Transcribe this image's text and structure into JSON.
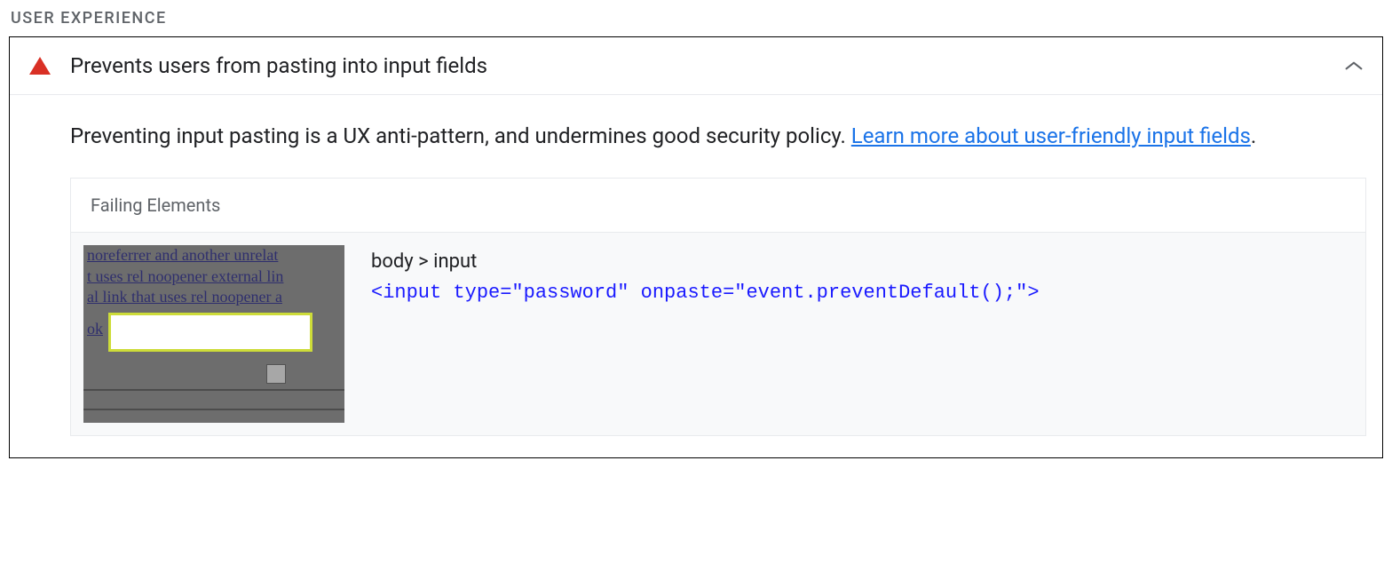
{
  "section": {
    "header": "USER EXPERIENCE"
  },
  "audit": {
    "title": "Prevents users from pasting into input fields",
    "description_prefix": "Preventing input pasting is a UX anti-pattern, and undermines good security policy. ",
    "link_text": "Learn more about user-friendly input fields",
    "description_suffix": ".",
    "details": {
      "header": "Failing Elements",
      "selector": "body > input",
      "snippet": "<input type=\"password\" onpaste=\"event.preventDefault();\">"
    },
    "thumbnail": {
      "line1": " noreferrer and another unrelat",
      "line2": "t uses rel noopener external lin",
      "line3": "al link that uses rel noopener a",
      "ok": "ok"
    }
  }
}
